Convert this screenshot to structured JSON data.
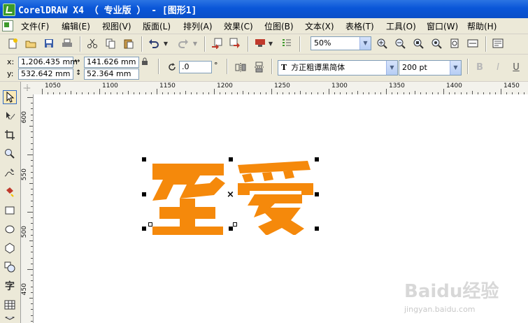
{
  "window": {
    "title": "CorelDRAW X4 （ 专业版 ） - [图形1]"
  },
  "menu": [
    {
      "label": "文件(F)"
    },
    {
      "label": "编辑(E)"
    },
    {
      "label": "视图(V)"
    },
    {
      "label": "版面(L)"
    },
    {
      "label": "排列(A)"
    },
    {
      "label": "效果(C)"
    },
    {
      "label": "位图(B)"
    },
    {
      "label": "文本(X)"
    },
    {
      "label": "表格(T)"
    },
    {
      "label": "工具(O)"
    },
    {
      "label": "窗口(W)"
    },
    {
      "label": "帮助(H)"
    }
  ],
  "standard_toolbar": {
    "zoom_value": "50%",
    "icons": [
      "new-icon",
      "open-icon",
      "save-icon",
      "print-icon",
      "cut-icon",
      "copy-icon",
      "paste-icon",
      "undo-icon",
      "redo-icon",
      "import-icon",
      "export-icon",
      "app-launcher-icon",
      "welcome-icon",
      "zoom-in-icon",
      "zoom-out-icon",
      "zoom-selected-icon",
      "zoom-all-icon",
      "zoom-page-icon",
      "zoom-width-icon",
      "options-icon"
    ]
  },
  "property_bar": {
    "x_label": "x:",
    "x_value": "1,206.435 mm",
    "y_label": "y:",
    "y_value": "532.642 mm",
    "width_value": "141.626 mm",
    "height_value": "52.364 mm",
    "rotation_value": ".0",
    "rotation_unit": "°",
    "font_name": "方正粗谭黑简体",
    "font_size": "200 pt",
    "text_tool_glyph": "T"
  },
  "rulers": {
    "horizontal": [
      "1050",
      "1100",
      "1150",
      "1200",
      "1250",
      "1300",
      "1350",
      "1400",
      "1450"
    ],
    "vertical": [
      "600",
      "550",
      "500",
      "450"
    ]
  },
  "toolbox": {
    "items": [
      "pick-tool-icon",
      "shape-tool-icon",
      "crop-tool-icon",
      "zoom-tool-icon",
      "freehand-tool-icon",
      "smart-fill-tool-icon",
      "rectangle-tool-icon",
      "ellipse-tool-icon",
      "polygon-tool-icon",
      "basic-shapes-tool-icon",
      "text-tool",
      "table-tool-icon",
      "interactive-tool-icon"
    ],
    "text_tool_label": "字"
  },
  "canvas": {
    "artwork_text": "至爱",
    "artwork_color": "#f5890b",
    "center_marker": "×"
  },
  "watermark": {
    "main": "Baidu经验",
    "sub": "jingyan.baidu.com"
  }
}
